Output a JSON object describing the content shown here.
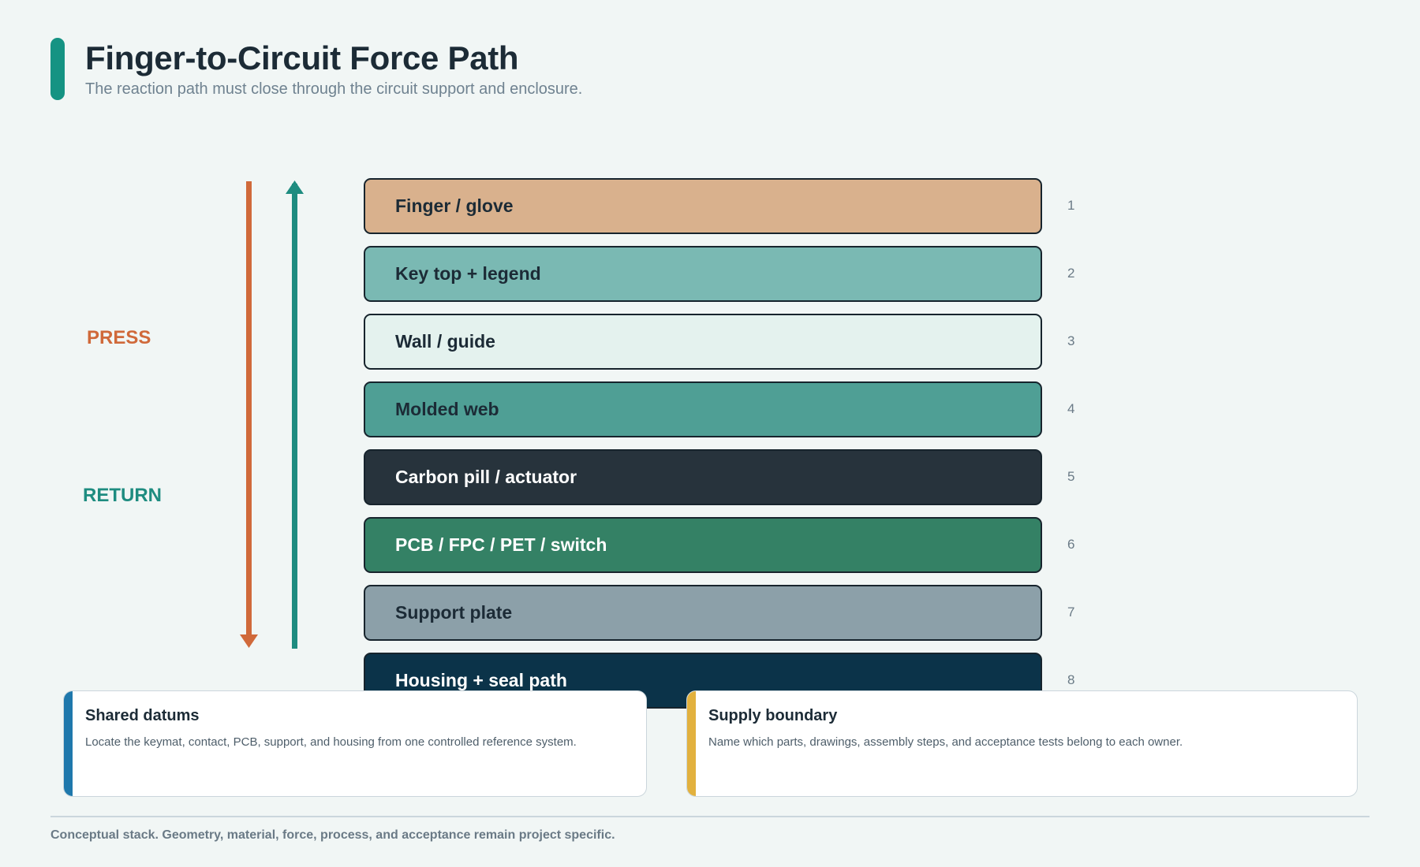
{
  "header": {
    "title": "Finger-to-Circuit Force Path",
    "subtitle": "The reaction path must close through the circuit support and enclosure."
  },
  "side_labels": {
    "press": "PRESS",
    "return": "RETURN"
  },
  "colors": {
    "accent": "#159383",
    "press": "#d0693a",
    "return": "#1e8c80"
  },
  "layers": [
    {
      "label": "Finger / glove",
      "number": "1",
      "fill": "#d9b18d",
      "text": "#1c2b36"
    },
    {
      "label": "Key top + legend",
      "number": "2",
      "fill": "#7ab9b3",
      "text": "#1c2b36"
    },
    {
      "label": "Wall / guide",
      "number": "3",
      "fill": "#e4f2ee",
      "text": "#1c2b36"
    },
    {
      "label": "Molded web",
      "number": "4",
      "fill": "#4f9f95",
      "text": "#1c2b36"
    },
    {
      "label": "Carbon pill / actuator",
      "number": "5",
      "fill": "#27333c",
      "text": "#ffffff"
    },
    {
      "label": "PCB / FPC / PET / switch",
      "number": "6",
      "fill": "#348165",
      "text": "#ffffff"
    },
    {
      "label": "Support plate",
      "number": "7",
      "fill": "#8ca0a9",
      "text": "#1c2b36"
    },
    {
      "label": "Housing + seal path",
      "number": "8",
      "fill": "#0b3349",
      "text": "#ffffff"
    }
  ],
  "cards": [
    {
      "title": "Shared datums",
      "body": "Locate the keymat, contact, PCB, support, and housing from one controlled reference system.",
      "stripe": "#1f78ac"
    },
    {
      "title": "Supply boundary",
      "body": "Name which parts, drawings, assembly steps, and acceptance tests belong to each owner.",
      "stripe": "#e2b13e"
    }
  ],
  "footer": "Conceptual stack. Geometry, material, force, process, and acceptance remain project specific."
}
